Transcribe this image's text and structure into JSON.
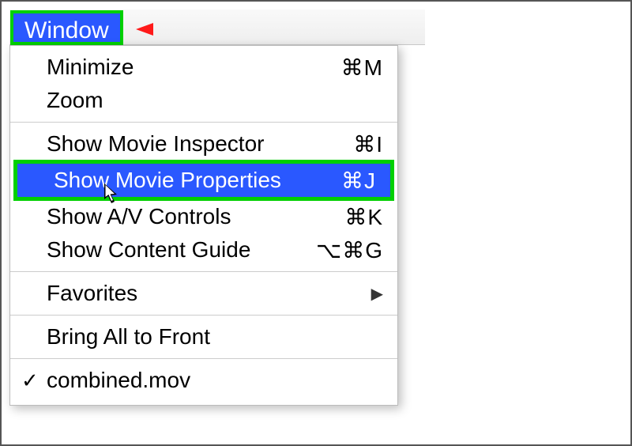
{
  "menubar": {
    "title": "Window"
  },
  "menu": {
    "minimize": {
      "label": "Minimize",
      "shortcut": "⌘M"
    },
    "zoom": {
      "label": "Zoom",
      "shortcut": ""
    },
    "inspector": {
      "label": "Show Movie Inspector",
      "shortcut": "⌘I"
    },
    "properties": {
      "label": "Show Movie Properties",
      "shortcut": "⌘J"
    },
    "avcontrols": {
      "label": "Show A/V Controls",
      "shortcut": "⌘K"
    },
    "contentguide": {
      "label": "Show Content Guide",
      "shortcut": "⌥⌘G"
    },
    "favorites": {
      "label": "Favorites",
      "shortcut": ""
    },
    "bringfront": {
      "label": "Bring All to Front",
      "shortcut": ""
    },
    "windowdoc": {
      "label": "combined.mov",
      "shortcut": ""
    }
  }
}
